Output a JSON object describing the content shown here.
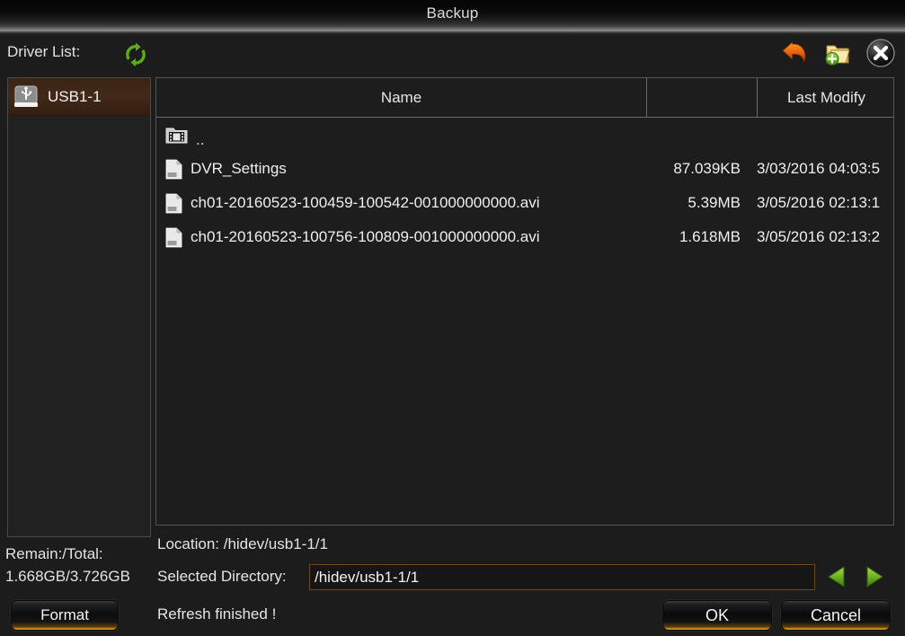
{
  "window": {
    "title": "Backup"
  },
  "toolbar": {
    "driver_list_label": "Driver List:",
    "refresh_icon": "refresh-icon",
    "back_icon": "undo-arrow-icon",
    "new_folder_icon": "new-folder-icon",
    "close_icon": "close-icon"
  },
  "drivers": {
    "items": [
      {
        "label": "USB1-1",
        "icon": "usb-drive-icon",
        "selected": true
      }
    ]
  },
  "storage": {
    "remain_total_label": "Remain:/Total:",
    "remain_total_value": "1.668GB/3.726GB",
    "format_label": "Format"
  },
  "file_list": {
    "columns": [
      {
        "key": "name",
        "label": "Name"
      },
      {
        "key": "size",
        "label": ""
      },
      {
        "key": "date",
        "label": "Last Modify"
      }
    ],
    "rows": [
      {
        "icon": "parent-directory-icon",
        "name": "..",
        "size": "",
        "date": ""
      },
      {
        "icon": "document-icon",
        "name": "DVR_Settings",
        "size": "87.039KB",
        "date": "3/03/2016 04:03:5"
      },
      {
        "icon": "document-icon",
        "name": "ch01-20160523-100459-100542-001000000000.avi",
        "size": "5.39MB",
        "date": "3/05/2016 02:13:1"
      },
      {
        "icon": "document-icon",
        "name": "ch01-20160523-100756-100809-001000000000.avi",
        "size": "1.618MB",
        "date": "3/05/2016 02:13:2"
      }
    ]
  },
  "footer": {
    "location_text": "Location: /hidev/usb1-1/1",
    "selected_directory_label": "Selected Directory:",
    "selected_directory_value": "/hidev/usb1-1/1",
    "status_message": "Refresh finished !",
    "prev_icon": "arrow-left-icon",
    "next_icon": "arrow-right-icon",
    "ok_label": "OK",
    "cancel_label": "Cancel"
  },
  "colors": {
    "background": "#1c1c1c",
    "accent_gold": "#f0a81c",
    "accent_green": "#6ab023",
    "selection": "#42291a",
    "text": "#e8e8e8"
  }
}
